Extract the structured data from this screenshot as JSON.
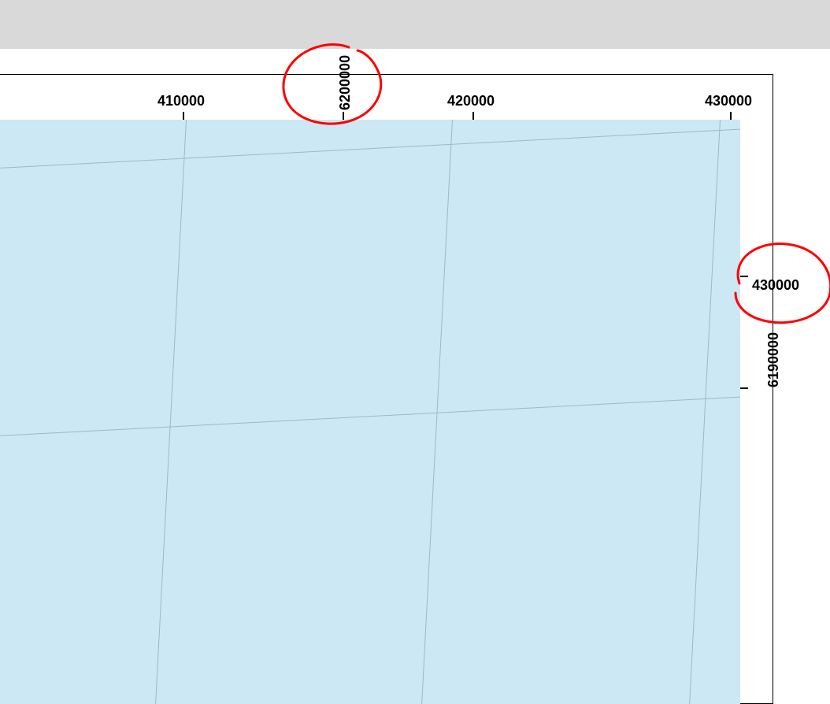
{
  "top_axis_labels": {
    "t0": "410000",
    "t1": "6200000",
    "t2": "420000",
    "t3": "430000"
  },
  "right_axis_labels": {
    "r0": "430000",
    "r1": "6190000"
  }
}
